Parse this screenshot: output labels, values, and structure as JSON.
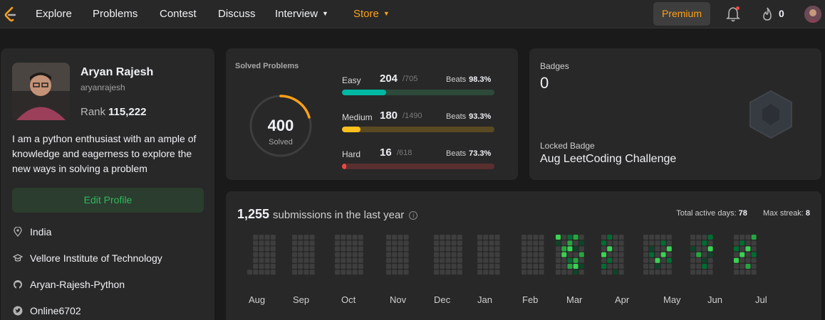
{
  "nav": {
    "items": [
      {
        "label": "Explore"
      },
      {
        "label": "Problems"
      },
      {
        "label": "Contest"
      },
      {
        "label": "Discuss"
      },
      {
        "label": "Interview"
      },
      {
        "label": "Store"
      }
    ],
    "premium_label": "Premium",
    "streak_count": "0",
    "accent": "#ffa116"
  },
  "profile": {
    "name": "Aryan Rajesh",
    "username": "aryanrajesh",
    "rank_label": "Rank",
    "rank_value": "115,222",
    "bio": "I am a python enthusiast with an ample of knowledge and eagerness to explore the new ways in solving a problem",
    "edit_label": "Edit Profile",
    "location": "India",
    "school": "Vellore Institute of Technology",
    "github": "Aryan-Rajesh-Python",
    "twitter": "Online6702"
  },
  "solved": {
    "title": "Solved Problems",
    "total": "400",
    "total_label": "Solved",
    "difficulties": [
      {
        "name": "Easy",
        "solved": "204",
        "total": "/705",
        "beats_label": "Beats",
        "beats": "98.3%",
        "color": "#00b8a3",
        "track": "#2d4a3a"
      },
      {
        "name": "Medium",
        "solved": "180",
        "total": "/1490",
        "beats_label": "Beats",
        "beats": "93.3%",
        "color": "#ffc01e",
        "track": "#5a4a22"
      },
      {
        "name": "Hard",
        "solved": "16",
        "total": "/618",
        "beats_label": "Beats",
        "beats": "73.3%",
        "color": "#ef4743",
        "track": "#5a2f2f"
      }
    ]
  },
  "badges": {
    "title": "Badges",
    "count": "0",
    "locked_label": "Locked Badge",
    "locked_name": "Aug LeetCoding Challenge"
  },
  "submissions": {
    "count": "1,255",
    "label": "submissions in the last year",
    "active_days_label": "Total active days:",
    "active_days": "78",
    "max_streak_label": "Max streak:",
    "max_streak": "8",
    "months": [
      "Aug",
      "Sep",
      "Oct",
      "Nov",
      "Dec",
      "Jan",
      "Feb",
      "Mar",
      "Apr",
      "May",
      "Jun",
      "Jul"
    ]
  }
}
